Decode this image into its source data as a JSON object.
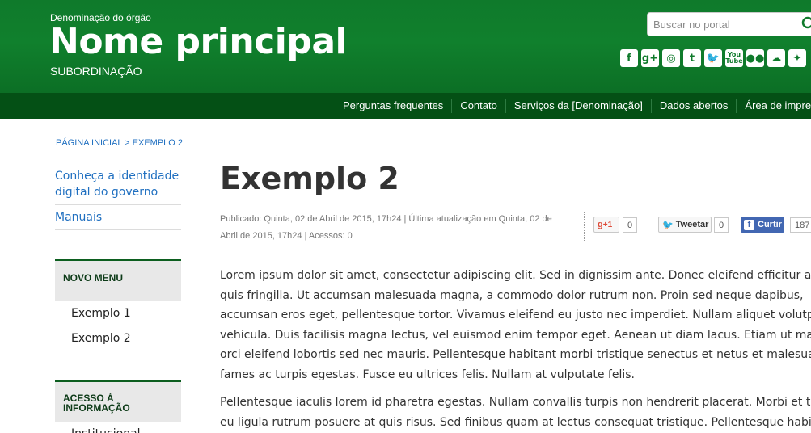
{
  "header": {
    "org_name": "Denominação do órgão",
    "main_name": "Nome principal",
    "subordination": "SUBORDINAÇÃO",
    "search_placeholder": "Buscar no portal",
    "bg_color": "#0f7a2b",
    "social_icons": [
      {
        "name": "facebook-icon",
        "glyph": "f"
      },
      {
        "name": "google-plus-icon",
        "glyph": "g+"
      },
      {
        "name": "instagram-icon",
        "glyph": "◎"
      },
      {
        "name": "tumblr-icon",
        "glyph": "t"
      },
      {
        "name": "twitter-icon",
        "glyph": "🐦"
      },
      {
        "name": "youtube-icon",
        "glyph": "You Tube"
      },
      {
        "name": "flickr-icon",
        "glyph": "●●"
      },
      {
        "name": "soundcloud-icon",
        "glyph": "☁"
      },
      {
        "name": "slideshare-icon",
        "glyph": "✦"
      }
    ]
  },
  "nav": {
    "links": [
      "Perguntas frequentes",
      "Contato",
      "Serviços da [Denominação]",
      "Dados abertos",
      "Área de imprensa"
    ],
    "bg_color": "#045015"
  },
  "sidebar": {
    "breadcrumb": "PÁGINA INICIAL > EXEMPLO 2",
    "links": [
      "Conheça a identidade digital do governo",
      "Manuais"
    ],
    "menus": [
      {
        "title": "NOVO MENU",
        "items": [
          "Exemplo 1",
          "Exemplo 2"
        ]
      },
      {
        "title": "ACESSO À INFORMAÇÃO",
        "items": [
          "Institucional"
        ]
      }
    ]
  },
  "content": {
    "title": "Exemplo 2",
    "meta": "Publicado: Quinta, 02 de Abril de 2015, 17h24 | Última atualização em Quinta, 02 de Abril de 2015, 17h24 | Acessos: 0",
    "share": {
      "gplus_label": "+1",
      "gplus_count": "0",
      "tweet_label": "Tweetar",
      "tweet_count": "0",
      "fb_label": "Curtir",
      "fb_count": "187"
    },
    "paragraph1": [
      "Lorem ipsum dolor sit amet, consectetur adipiscing elit. Sed in dignissim ante. Donec eleifend efficitur augue",
      "quis fringilla. Ut accumsan malesuada magna, a commodo dolor rutrum non. Proin sed neque dapibus,",
      "accumsan eros eget, pellentesque tortor. Vivamus eleifend eu justo nec imperdiet. Nullam aliquet volutpat",
      "vehicula. Duis facilisis magna lectus, vel euismod enim tempor eget. Aenean ut diam lacus. Etiam ut magna a",
      "orci eleifend lobortis sed nec mauris. Pellentesque habitant morbi tristique senectus et netus et malesuada",
      "fames ac turpis egestas. Fusce eu ultrices felis. Nullam at vulputate felis."
    ],
    "paragraph2": [
      "Pellentesque iaculis lorem id pharetra egestas. Nullam convallis turpis non hendrerit placerat. Morbi et tortor",
      "eu ligula rutrum posuere at quis risus. Sed finibus quam at lectus consequat tristique. Pellentesque habitant"
    ]
  }
}
